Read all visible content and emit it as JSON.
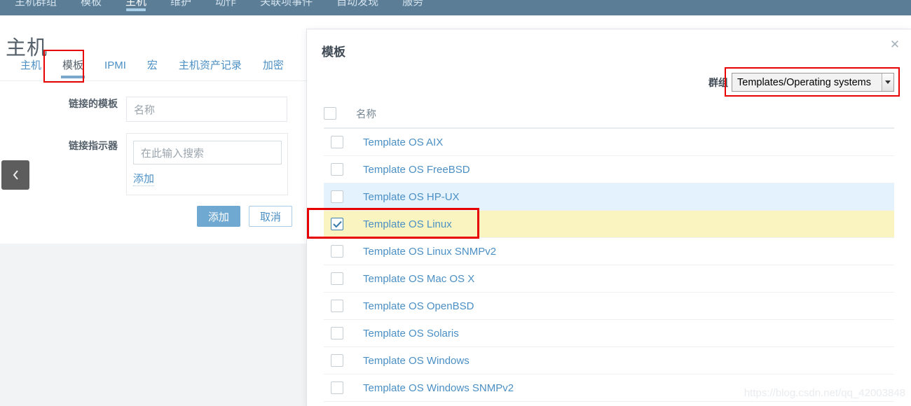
{
  "topnav": {
    "items": [
      {
        "label": "主机群组",
        "active": false
      },
      {
        "label": "模板",
        "active": false
      },
      {
        "label": "主机",
        "active": true
      },
      {
        "label": "维护",
        "active": false
      },
      {
        "label": "动作",
        "active": false
      },
      {
        "label": "关联项事件",
        "active": false
      },
      {
        "label": "自动发现",
        "active": false
      },
      {
        "label": "服务",
        "active": false
      }
    ]
  },
  "page": {
    "title": "主机",
    "tabs": [
      {
        "label": "主机",
        "active": false
      },
      {
        "label": "模板",
        "active": true
      },
      {
        "label": "IPMI",
        "active": false
      },
      {
        "label": "宏",
        "active": false
      },
      {
        "label": "主机资产记录",
        "active": false
      },
      {
        "label": "加密",
        "active": false
      }
    ]
  },
  "form": {
    "linked_templates_label": "链接的模板",
    "linked_templates_placeholder": "名称",
    "link_indicator_label": "链接指示器",
    "search_placeholder": "在此输入搜索",
    "add_link": "添加",
    "submit_label": "添加",
    "cancel_label": "取消",
    "collapse_icon": "chevron-left-icon"
  },
  "modal": {
    "title": "模板",
    "close_icon": "close-icon",
    "filter_label": "群组",
    "selected_group": "Templates/Operating systems",
    "group_options": [
      "Templates/Operating systems"
    ],
    "column_header": "名称",
    "rows": [
      {
        "label": "Template OS AIX",
        "checked": false,
        "highlight": "none"
      },
      {
        "label": "Template OS FreeBSD",
        "checked": false,
        "highlight": "none"
      },
      {
        "label": "Template OS HP-UX",
        "checked": false,
        "highlight": "blue"
      },
      {
        "label": "Template OS Linux",
        "checked": true,
        "highlight": "yellow"
      },
      {
        "label": "Template OS Linux SNMPv2",
        "checked": false,
        "highlight": "none"
      },
      {
        "label": "Template OS Mac OS X",
        "checked": false,
        "highlight": "none"
      },
      {
        "label": "Template OS OpenBSD",
        "checked": false,
        "highlight": "none"
      },
      {
        "label": "Template OS Solaris",
        "checked": false,
        "highlight": "none"
      },
      {
        "label": "Template OS Windows",
        "checked": false,
        "highlight": "none"
      },
      {
        "label": "Template OS Windows SNMPv2",
        "checked": false,
        "highlight": "none"
      }
    ]
  },
  "watermark": "https://blog.csdn.net/qq_42003848",
  "colors": {
    "topnav_bg": "#5b7d96",
    "link": "#4b8fc4",
    "annotation_red": "#e60000",
    "row_highlight_blue": "#e3f2fd",
    "row_highlight_yellow": "#faf5c0",
    "primary_button": "#6fa8d1"
  }
}
